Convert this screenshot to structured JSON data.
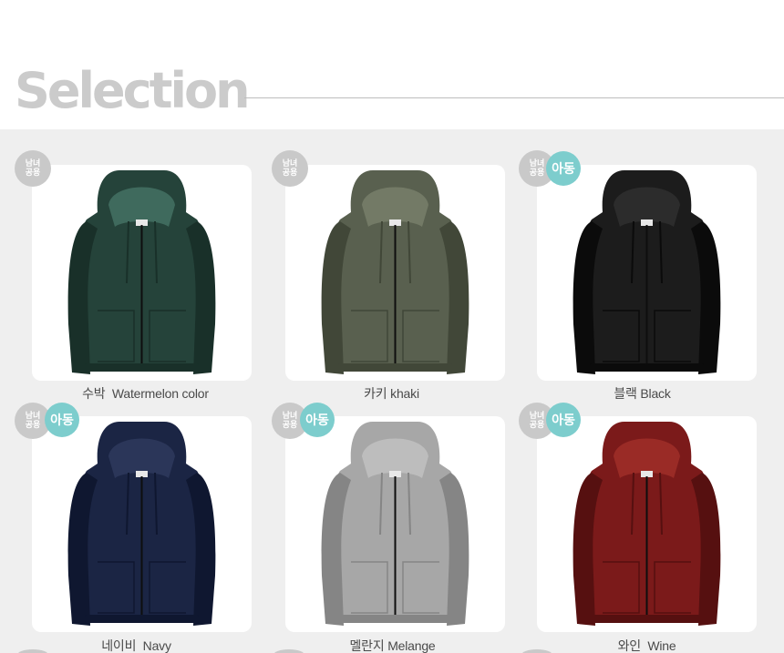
{
  "header": {
    "title": "Selection"
  },
  "badges": {
    "unisex": "남녀\n공용",
    "kids": "아동"
  },
  "colors": {
    "accent_kids": "#7dcdcd",
    "badge_gray": "#c9c9c9",
    "page_bg": "#efefef"
  },
  "products": [
    {
      "caption": "수박  Watermelon color",
      "fill": "#25433a",
      "shade": "#193029",
      "lining": "#3f6a5d",
      "kids": false
    },
    {
      "caption": "카키 khaki",
      "fill": "#59604f",
      "shade": "#414738",
      "lining": "#737a66",
      "kids": false
    },
    {
      "caption": "블랙 Black",
      "fill": "#1c1c1c",
      "shade": "#0b0b0b",
      "lining": "#2c2c2c",
      "kids": true
    },
    {
      "caption": "네이비  Navy",
      "fill": "#1b2544",
      "shade": "#0f1730",
      "lining": "#2b3659",
      "kids": true
    },
    {
      "caption": "멜란지 Melange",
      "fill": "#a7a7a7",
      "shade": "#858585",
      "lining": "#bdbdbd",
      "kids": true
    },
    {
      "caption": "와인  Wine",
      "fill": "#7b1a1a",
      "shade": "#561010",
      "lining": "#9a2b26",
      "kids": true
    }
  ]
}
